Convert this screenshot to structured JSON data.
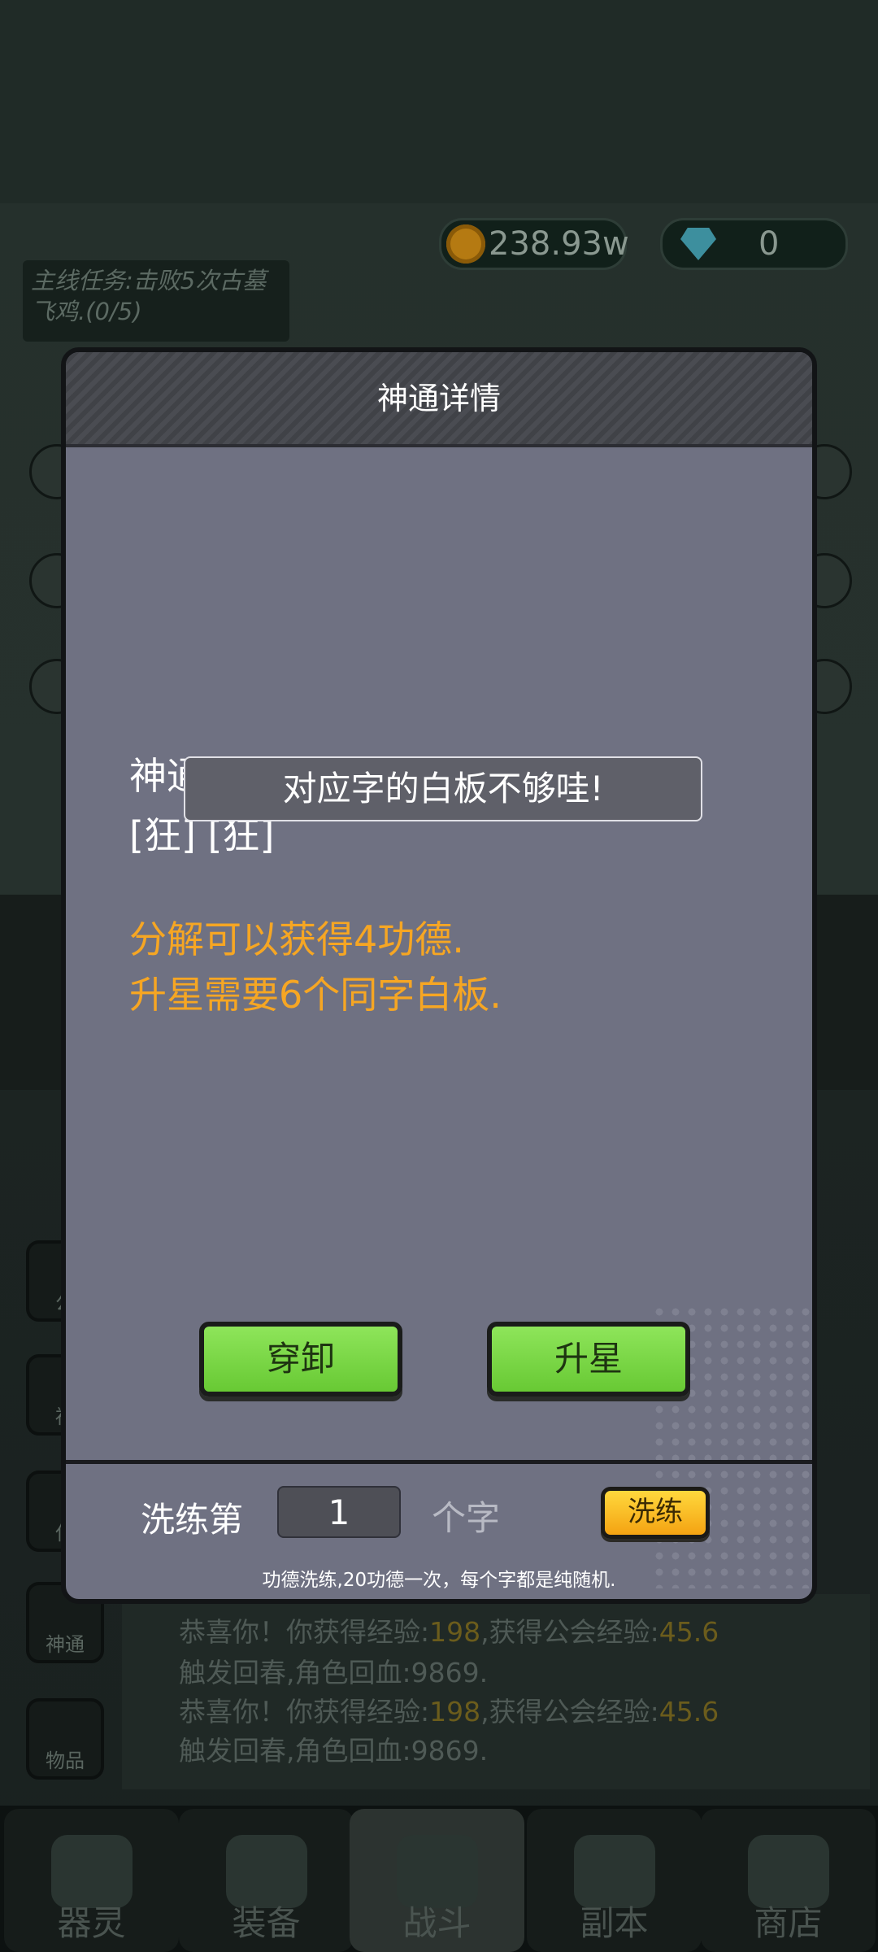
{
  "currency": {
    "coins": "238.93w",
    "gems": "0"
  },
  "task": {
    "text": "主线任务:击败5次古墓飞鸡.(0/5)"
  },
  "left_buttons": [
    "公",
    "福",
    "任",
    "神通",
    "物品"
  ],
  "log": [
    {
      "a": "恭喜你！你获得经验:",
      "v1": "198",
      "b": ",获得公会经验:",
      "v2": "45.6"
    },
    {
      "a": "触发回春,角色回血:9869."
    },
    {
      "a": "恭喜你！你获得经验:",
      "v1": "198",
      "b": ",获得公会经验:",
      "v2": "45.6"
    },
    {
      "a": "触发回春,角色回血:9869."
    }
  ],
  "nav": [
    "器灵",
    "装备",
    "战斗",
    "副本",
    "商店"
  ],
  "modal": {
    "title": "神通详情",
    "label": "神通:",
    "chars": "[狂]  [狂]",
    "toast": "对应字的白板不够哇!",
    "info1": "分解可以获得4功德.",
    "info2": "升星需要6个同字白板.",
    "btn_wear": "穿卸",
    "btn_star": "升星",
    "refine_prefix": "洗练第",
    "refine_value": "1",
    "refine_suffix": "个字",
    "refine_btn": "洗练",
    "note": "功德洗练,20功德一次，每个字都是纯随机."
  }
}
